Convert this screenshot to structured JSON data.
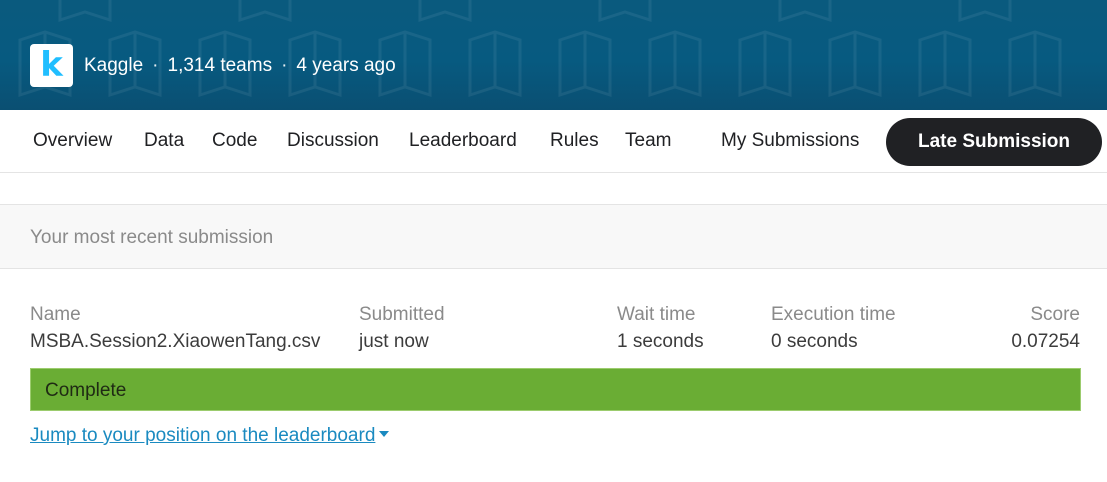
{
  "header": {
    "logo_letter": "k",
    "org": "Kaggle",
    "separator": "·",
    "teams": "1,314 teams",
    "age": "4 years ago",
    "colors": {
      "banner": "#075a80",
      "logo_letter": "#20beff"
    }
  },
  "tabs": [
    {
      "label": "Overview"
    },
    {
      "label": "Data"
    },
    {
      "label": "Code"
    },
    {
      "label": "Discussion"
    },
    {
      "label": "Leaderboard"
    },
    {
      "label": "Rules"
    },
    {
      "label": "Team"
    },
    {
      "label": "My Submissions"
    }
  ],
  "late_submission_label": "Late Submission",
  "recent": {
    "title": "Your most recent submission",
    "columns": {
      "name": {
        "label": "Name",
        "value": "MSBA.Session2.XiaowenTang.csv"
      },
      "submitted": {
        "label": "Submitted",
        "value": "just now"
      },
      "wait": {
        "label": "Wait time",
        "value": "1 seconds"
      },
      "execution": {
        "label": "Execution time",
        "value": "0 seconds"
      },
      "score": {
        "label": "Score",
        "value": "0.07254"
      }
    },
    "status": "Complete",
    "status_color": "#6aad34",
    "jump_link": "Jump to your position on the leaderboard"
  }
}
